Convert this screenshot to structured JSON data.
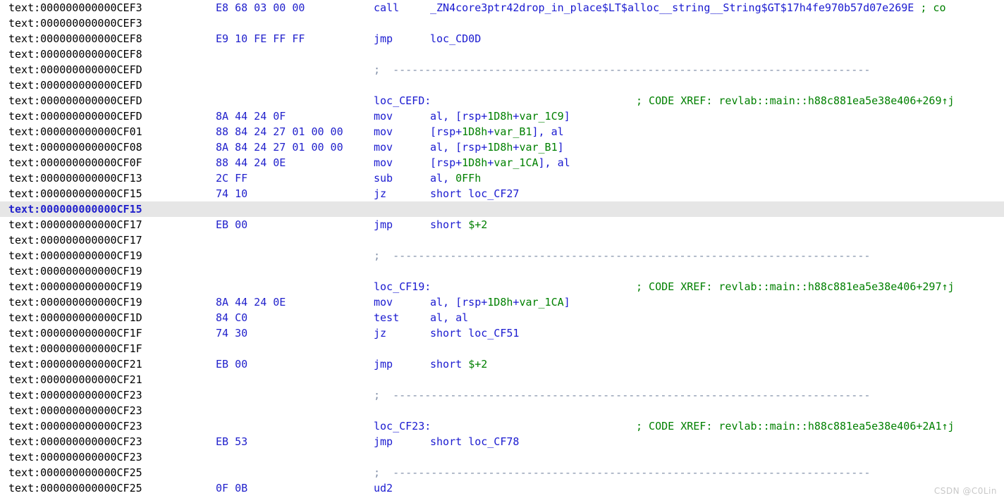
{
  "view": {
    "name": "ida-disassembly-listing",
    "segment_prefix": "text:",
    "watermark": "CSDN @C0Lin",
    "colors": {
      "address": "#000000",
      "bytes": "#2222cc",
      "mnemonic": "#1a1ad0",
      "identifier_green": "#008000",
      "comment": "#008000",
      "separator": "#8290a8",
      "highlight_background": "#e6e6e6",
      "background": "#ffffff"
    }
  },
  "separator_text": ";  ---------------------------------------------------------------------------",
  "rows": [
    {
      "addr": "text:000000000000CEF3",
      "bytes": "E8 68 03 00 00",
      "mnem": "call",
      "ops_html": "<span class=\"b\">_ZN4core3ptr42drop_in_place$LT$alloc__string__String$GT$17h4fe970b57d07e269E</span>",
      "cmt": "",
      "cmt_inline": "; co",
      "kind": "instruction",
      "highlight": false
    },
    {
      "addr": "text:000000000000CEF3",
      "bytes": "",
      "mnem": "",
      "ops_html": "",
      "cmt": "",
      "kind": "blank",
      "highlight": false
    },
    {
      "addr": "text:000000000000CEF8",
      "bytes": "E9 10 FE FF FF",
      "mnem": "jmp",
      "ops_html": "<span class=\"b\">loc_CD0D</span>",
      "cmt": "",
      "kind": "instruction",
      "highlight": false
    },
    {
      "addr": "text:000000000000CEF8",
      "bytes": "",
      "mnem": "",
      "ops_html": "",
      "cmt": "",
      "kind": "blank",
      "highlight": false
    },
    {
      "addr": "text:000000000000CEFD",
      "bytes": "",
      "mnem": "",
      "ops_html": "",
      "cmt": "",
      "kind": "separator",
      "highlight": false
    },
    {
      "addr": "text:000000000000CEFD",
      "bytes": "",
      "mnem": "",
      "ops_html": "",
      "cmt": "",
      "kind": "blank",
      "highlight": false
    },
    {
      "addr": "text:000000000000CEFD",
      "bytes": "",
      "label": "loc_CEFD:",
      "cmt": "; CODE XREF: revlab::main::h88c881ea5e38e406+269↑j",
      "kind": "label",
      "highlight": false
    },
    {
      "addr": "text:000000000000CEFD",
      "bytes": "8A 44 24 0F",
      "mnem": "mov",
      "ops_html": "al, [rsp+<span class=\"g\">1D8h</span>+<span class=\"g\">var_1C9</span>]",
      "cmt": "",
      "kind": "instruction",
      "highlight": false
    },
    {
      "addr": "text:000000000000CF01",
      "bytes": "88 84 24 27 01 00 00",
      "mnem": "mov",
      "ops_html": "[rsp+<span class=\"g\">1D8h</span>+<span class=\"g\">var_B1</span>], al",
      "cmt": "",
      "kind": "instruction",
      "highlight": false
    },
    {
      "addr": "text:000000000000CF08",
      "bytes": "8A 84 24 27 01 00 00",
      "mnem": "mov",
      "ops_html": "al, [rsp+<span class=\"g\">1D8h</span>+<span class=\"g\">var_B1</span>]",
      "cmt": "",
      "kind": "instruction",
      "highlight": false
    },
    {
      "addr": "text:000000000000CF0F",
      "bytes": "88 44 24 0E",
      "mnem": "mov",
      "ops_html": "[rsp+<span class=\"g\">1D8h</span>+<span class=\"g\">var_1CA</span>], al",
      "cmt": "",
      "kind": "instruction",
      "highlight": false
    },
    {
      "addr": "text:000000000000CF13",
      "bytes": "2C FF",
      "mnem": "sub",
      "ops_html": "al, <span class=\"g\">0FFh</span>",
      "cmt": "",
      "kind": "instruction",
      "highlight": false
    },
    {
      "addr": "text:000000000000CF15",
      "bytes": "74 10",
      "mnem": "jz",
      "ops_html": "short loc_CF27",
      "cmt": "",
      "kind": "instruction",
      "highlight": false
    },
    {
      "addr": "text:000000000000CF15",
      "bytes": "",
      "mnem": "",
      "ops_html": "",
      "cmt": "",
      "kind": "blank",
      "highlight": true
    },
    {
      "addr": "text:000000000000CF17",
      "bytes": "EB 00",
      "mnem": "jmp",
      "ops_html": "short <span class=\"g\">$+2</span>",
      "cmt": "",
      "kind": "instruction",
      "highlight": false
    },
    {
      "addr": "text:000000000000CF17",
      "bytes": "",
      "mnem": "",
      "ops_html": "",
      "cmt": "",
      "kind": "blank",
      "highlight": false
    },
    {
      "addr": "text:000000000000CF19",
      "bytes": "",
      "mnem": "",
      "ops_html": "",
      "cmt": "",
      "kind": "separator",
      "highlight": false
    },
    {
      "addr": "text:000000000000CF19",
      "bytes": "",
      "mnem": "",
      "ops_html": "",
      "cmt": "",
      "kind": "blank",
      "highlight": false
    },
    {
      "addr": "text:000000000000CF19",
      "bytes": "",
      "label": "loc_CF19:",
      "cmt": "; CODE XREF: revlab::main::h88c881ea5e38e406+297↑j",
      "kind": "label",
      "highlight": false
    },
    {
      "addr": "text:000000000000CF19",
      "bytes": "8A 44 24 0E",
      "mnem": "mov",
      "ops_html": "al, [rsp+<span class=\"g\">1D8h</span>+<span class=\"g\">var_1CA</span>]",
      "cmt": "",
      "kind": "instruction",
      "highlight": false
    },
    {
      "addr": "text:000000000000CF1D",
      "bytes": "84 C0",
      "mnem": "test",
      "ops_html": "al, al",
      "cmt": "",
      "kind": "instruction",
      "highlight": false
    },
    {
      "addr": "text:000000000000CF1F",
      "bytes": "74 30",
      "mnem": "jz",
      "ops_html": "short loc_CF51",
      "cmt": "",
      "kind": "instruction",
      "highlight": false
    },
    {
      "addr": "text:000000000000CF1F",
      "bytes": "",
      "mnem": "",
      "ops_html": "",
      "cmt": "",
      "kind": "blank",
      "highlight": false
    },
    {
      "addr": "text:000000000000CF21",
      "bytes": "EB 00",
      "mnem": "jmp",
      "ops_html": "short <span class=\"g\">$+2</span>",
      "cmt": "",
      "kind": "instruction",
      "highlight": false
    },
    {
      "addr": "text:000000000000CF21",
      "bytes": "",
      "mnem": "",
      "ops_html": "",
      "cmt": "",
      "kind": "blank",
      "highlight": false
    },
    {
      "addr": "text:000000000000CF23",
      "bytes": "",
      "mnem": "",
      "ops_html": "",
      "cmt": "",
      "kind": "separator",
      "highlight": false
    },
    {
      "addr": "text:000000000000CF23",
      "bytes": "",
      "mnem": "",
      "ops_html": "",
      "cmt": "",
      "kind": "blank",
      "highlight": false
    },
    {
      "addr": "text:000000000000CF23",
      "bytes": "",
      "label": "loc_CF23:",
      "cmt": "; CODE XREF: revlab::main::h88c881ea5e38e406+2A1↑j",
      "kind": "label",
      "highlight": false
    },
    {
      "addr": "text:000000000000CF23",
      "bytes": "EB 53",
      "mnem": "jmp",
      "ops_html": "short loc_CF78",
      "cmt": "",
      "kind": "instruction",
      "highlight": false
    },
    {
      "addr": "text:000000000000CF23",
      "bytes": "",
      "mnem": "",
      "ops_html": "",
      "cmt": "",
      "kind": "blank",
      "highlight": false
    },
    {
      "addr": "text:000000000000CF25",
      "bytes": "",
      "mnem": "",
      "ops_html": "",
      "cmt": "",
      "kind": "separator",
      "highlight": false
    },
    {
      "addr": "text:000000000000CF25",
      "bytes": "0F 0B",
      "mnem": "ud2",
      "ops_html": "",
      "cmt": "",
      "kind": "instruction",
      "highlight": false
    }
  ]
}
